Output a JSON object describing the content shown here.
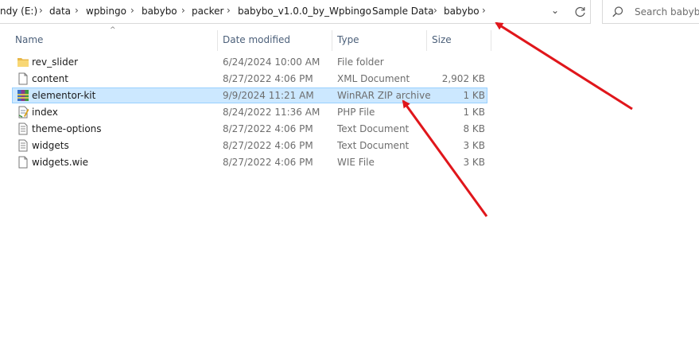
{
  "breadcrumb": {
    "items": [
      "ndy (E:)",
      "data",
      "wpbingo",
      "babybo",
      "packer",
      "babybo_v1.0.0_by_Wpbingo",
      "Sample Data",
      "babybo"
    ],
    "separator": "›",
    "dropdown_glyph": "⌄",
    "refresh_icon": "refresh-icon"
  },
  "search": {
    "placeholder": "Search babybo",
    "icon": "search-icon"
  },
  "columns": {
    "name": "Name",
    "date": "Date modified",
    "type": "Type",
    "size": "Size",
    "sort_glyph": "^"
  },
  "files": [
    {
      "name": "rev_slider",
      "date": "6/24/2024 10:00 AM",
      "type": "File folder",
      "size": "",
      "icon": "folder-icon"
    },
    {
      "name": "content",
      "date": "8/27/2022 4:06 PM",
      "type": "XML Document",
      "size": "2,902 KB",
      "icon": "file-icon"
    },
    {
      "name": "elementor-kit",
      "date": "9/9/2024 11:21 AM",
      "type": "WinRAR ZIP archive",
      "size": "1 KB",
      "icon": "winrar-icon",
      "selected": true
    },
    {
      "name": "index",
      "date": "8/24/2022 11:36 AM",
      "type": "PHP File",
      "size": "1 KB",
      "icon": "php-file-icon"
    },
    {
      "name": "theme-options",
      "date": "8/27/2022 4:06 PM",
      "type": "Text Document",
      "size": "8 KB",
      "icon": "text-file-icon"
    },
    {
      "name": "widgets",
      "date": "8/27/2022 4:06 PM",
      "type": "Text Document",
      "size": "3 KB",
      "icon": "text-file-icon"
    },
    {
      "name": "widgets.wie",
      "date": "8/27/2022 4:06 PM",
      "type": "WIE File",
      "size": "3 KB",
      "icon": "file-icon"
    }
  ],
  "colors": {
    "selection": "#cce8ff",
    "selection_border": "#99d1ff",
    "annotation": "#e0161b",
    "header_text": "#4c607a"
  },
  "annotations": [
    "red-arrow-to-address-bar",
    "red-arrow-to-zip-type"
  ]
}
